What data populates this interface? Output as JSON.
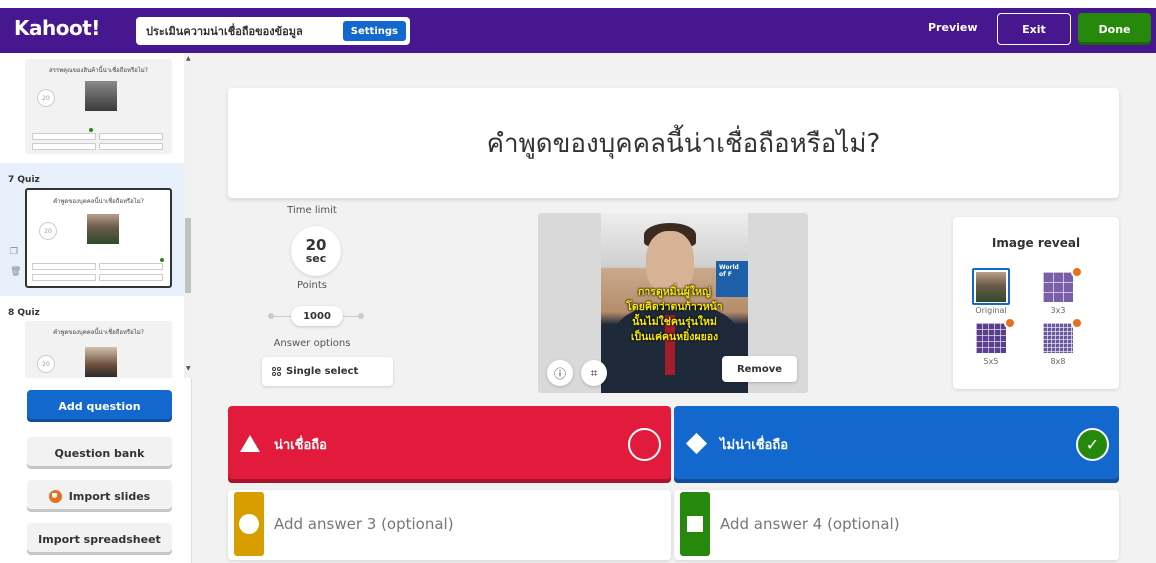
{
  "header": {
    "logo": "Kahoot!",
    "kahoot_title": "ประเมินความน่าเชื่อถือของข้อมูล",
    "settings_label": "Settings",
    "preview_label": "Preview",
    "exit_label": "Exit",
    "done_label": "Done",
    "brand_color": "#46178f"
  },
  "sidebar": {
    "slides": [
      {
        "label": "",
        "question": "สรรพคุณของสินค้านี้น่าเชื่อถือหรือไม่?",
        "time": "20"
      },
      {
        "label": "7 Quiz",
        "question": "คำพูดของบุคคลนี้น่าเชื่อถือหรือไม่?",
        "time": "20"
      },
      {
        "label": "8 Quiz",
        "question": "คำพูดของบุคคลนี้น่าเชื่อถือหรือไม่?",
        "time": "20"
      }
    ],
    "add_question": "Add question",
    "question_bank": "Question bank",
    "import_slides": "Import slides",
    "import_spreadsheet": "Import spreadsheet"
  },
  "question": {
    "text": "คำพูดของบุคคลนี้น่าเชื่อถือหรือไม่?"
  },
  "settings": {
    "time_limit_label": "Time limit",
    "time_value": "20",
    "time_unit": "sec",
    "points_label": "Points",
    "points_value": "1000",
    "answer_options_label": "Answer options",
    "answer_options_value": "Single select"
  },
  "media": {
    "caption_line1": "การดูหมิ่นผู้ใหญ่",
    "caption_line2": "โดยคิดว่าตนก้าวหน้า",
    "caption_line3": "นั้นไม่ใช่คนรุ่นใหม่",
    "caption_line4": "เป็นแค่คนหยิ่งผยอง",
    "sign_text": "World of F",
    "remove_label": "Remove"
  },
  "image_reveal": {
    "title": "Image reveal",
    "options": [
      "Original",
      "3x3",
      "5x5",
      "8x8"
    ]
  },
  "answers": [
    {
      "text": "น่าเชื่อถือ",
      "color": "#e21b3c",
      "correct": false
    },
    {
      "text": "ไม่น่าเชื่อถือ",
      "color": "#1368ce",
      "correct": true
    },
    {
      "placeholder": "Add answer 3 (optional)",
      "color": "#d89e00"
    },
    {
      "placeholder": "Add answer 4 (optional)",
      "color": "#26890c"
    }
  ]
}
